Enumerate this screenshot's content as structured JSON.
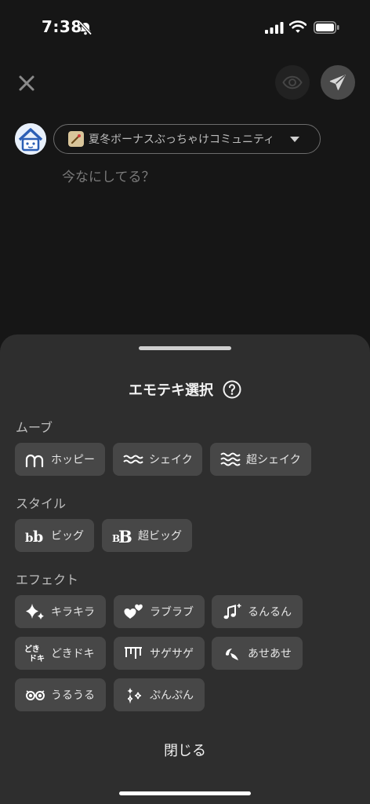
{
  "status_bar": {
    "time": "7:38"
  },
  "composer": {
    "community_name": "夏冬ボーナスぶっちゃけコミュニティ",
    "placeholder": "今なにしてる？"
  },
  "sheet": {
    "title": "エモテキ選択",
    "close_label": "閉じる",
    "sections": {
      "move": {
        "label": "ムーブ",
        "items": [
          "ホッピー",
          "シェイク",
          "超シェイク"
        ]
      },
      "style": {
        "label": "スタイル",
        "items": [
          "ビッグ",
          "超ビッグ"
        ]
      },
      "effect": {
        "label": "エフェクト",
        "items": [
          "キラキラ",
          "ラブラブ",
          "るんるん",
          "どきドキ",
          "サゲサゲ",
          "あせあせ",
          "うるうる",
          "ぷんぷん"
        ]
      }
    }
  },
  "colors": {
    "background": "#161616",
    "sheet": "#2e2e2e",
    "chip": "#474747",
    "text": "#e6e6e6"
  }
}
